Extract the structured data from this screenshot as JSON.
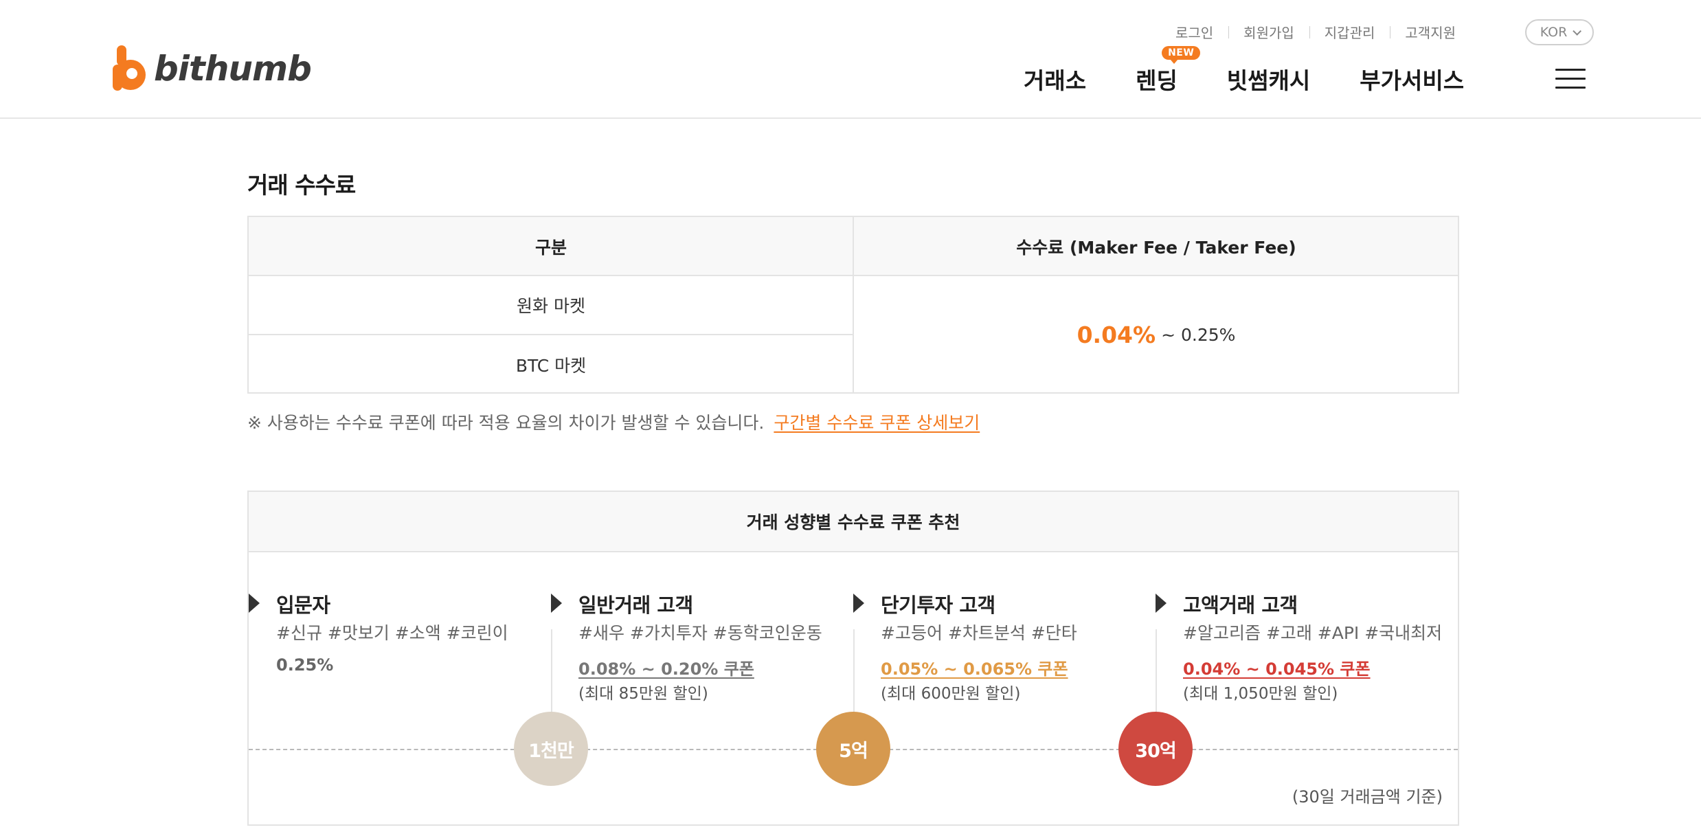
{
  "header": {
    "logo_text": "bithumb",
    "util_links": [
      "로그인",
      "회원가입",
      "지갑관리",
      "고객지원"
    ],
    "lang": "KOR",
    "nav": [
      {
        "label": "거래소"
      },
      {
        "label": "렌딩",
        "badge": "NEW"
      },
      {
        "label": "빗썸캐시"
      },
      {
        "label": "부가서비스"
      }
    ]
  },
  "fee_section": {
    "title": "거래 수수료",
    "headers": [
      "구분",
      "수수료 (Maker Fee / Taker Fee)"
    ],
    "rows": [
      "원화 마켓",
      "BTC 마켓"
    ],
    "fee_min": "0.04%",
    "fee_max": "~ 0.25%",
    "notice": "※ 사용하는 수수료 쿠폰에 따라 적용 요율의 차이가 발생할 수 있습니다.",
    "notice_link": "구간별 수수료 쿠폰 상세보기"
  },
  "coupon_section": {
    "title": "거래 성향별 수수료 쿠폰 추천",
    "tiers": [
      {
        "name": "입문자",
        "tags": "#신규 #맛보기 #소액 #코린이",
        "rate": "0.25%",
        "sub": "",
        "color": "#666666"
      },
      {
        "name": "일반거래 고객",
        "tags": "#새우 #가치투자 #동학코인운동",
        "rate": "0.08% ~ 0.20% 쿠폰",
        "sub": "(최대 85만원 할인)",
        "color": "#777777"
      },
      {
        "name": "단기투자 고객",
        "tags": "#고등어 #차트분석 #단타",
        "rate": "0.05% ~ 0.065% 쿠폰",
        "sub": "(최대 600만원 할인)",
        "color": "#e09a45"
      },
      {
        "name": "고액거래 고객",
        "tags": "#알고리즘 #고래 #API #국내최저",
        "rate": "0.04% ~ 0.045% 쿠폰",
        "sub": "(최대 1,050만원 할인)",
        "color": "#d43c35"
      }
    ],
    "markers": [
      {
        "label": "1천만",
        "color": "#dcd3c6"
      },
      {
        "label": "5억",
        "color": "#d6994f"
      },
      {
        "label": "30억",
        "color": "#cf4940"
      }
    ],
    "basis": "(30일 거래금액 기준)"
  },
  "colors": {
    "accent": "#f47b20",
    "border": "#e3e3e3",
    "head_bg": "#f8f8f8"
  }
}
